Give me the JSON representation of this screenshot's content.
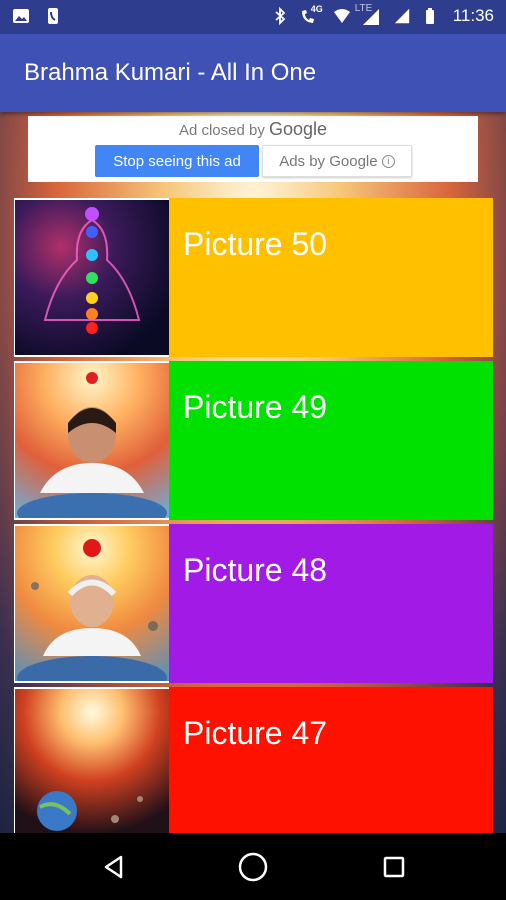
{
  "status_bar": {
    "time": "11:36",
    "network": "4G",
    "lte": "LTE",
    "icons": [
      "image-icon",
      "phone-icon",
      "bluetooth-icon",
      "wifi-calling-icon",
      "wifi-icon",
      "signal-icon",
      "battery-icon"
    ]
  },
  "app_bar": {
    "title": "Brahma Kumari - All In One",
    "color": "#3f51b5"
  },
  "ad": {
    "closed_prefix": "Ad closed by",
    "closed_brand": "Google",
    "stop_button": "Stop seeing this ad",
    "ads_by_button": "Ads by Google"
  },
  "items": [
    {
      "label": "Picture 50",
      "color": "#ffc000",
      "thumb": "chakra-meditation-image"
    },
    {
      "label": "Picture 49",
      "color": "#00e100",
      "thumb": "woman-portrait-image"
    },
    {
      "label": "Picture 48",
      "color": "#a21ae6",
      "thumb": "man-portrait-image"
    },
    {
      "label": "Picture 47",
      "color": "#ff1100",
      "thumb": "cosmic-light-image"
    }
  ],
  "nav_bar": {
    "buttons": [
      "back-icon",
      "home-icon",
      "recents-icon"
    ]
  }
}
